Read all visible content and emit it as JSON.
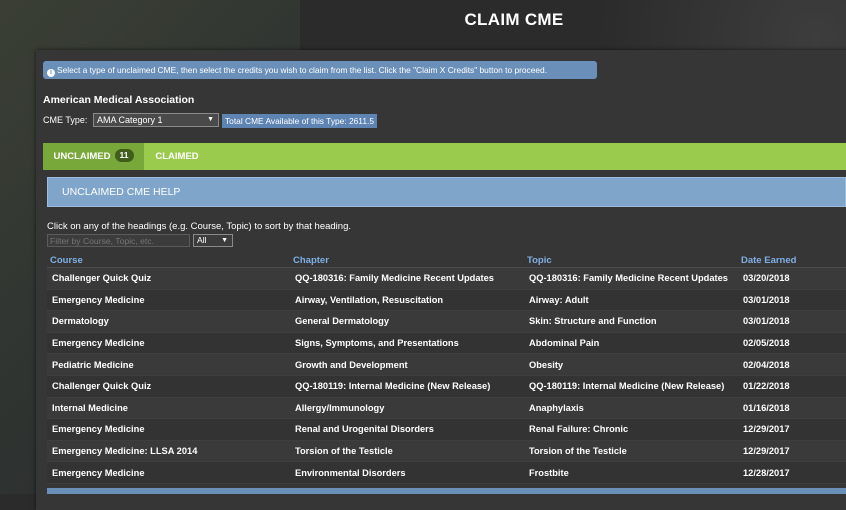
{
  "page": {
    "title": "CLAIM CME"
  },
  "info": {
    "text": "Select a type of unclaimed CME, then select the credits you wish to claim from the list. Click the \"Claim X Credits\" button to proceed."
  },
  "org": {
    "name": "American Medical Association"
  },
  "cme_type": {
    "label": "CME Type:",
    "selected": "AMA Category 1",
    "total_label": "Total CME Available of this Type: 2611.5"
  },
  "tabs": [
    {
      "label": "UNCLAIMED",
      "count": "11",
      "active": true
    },
    {
      "label": "CLAIMED",
      "active": false
    }
  ],
  "help": {
    "label": "UNCLAIMED CME HELP"
  },
  "sort_note": "Click on any of the headings (e.g. Course, Topic) to sort by that heading.",
  "filter": {
    "placeholder": "Filter by Course, Topic, etc.",
    "select_value": "All"
  },
  "table": {
    "headers": {
      "course": "Course",
      "chapter": "Chapter",
      "topic": "Topic",
      "date": "Date Earned"
    },
    "rows": [
      {
        "course": "Challenger Quick Quiz",
        "chapter": "QQ-180316: Family Medicine Recent Updates",
        "topic": "QQ-180316: Family Medicine Recent Updates",
        "date": "03/20/2018"
      },
      {
        "course": "Emergency Medicine",
        "chapter": "Airway, Ventilation, Resuscitation",
        "topic": "Airway: Adult",
        "date": "03/01/2018"
      },
      {
        "course": "Dermatology",
        "chapter": "General Dermatology",
        "topic": "Skin: Structure and Function",
        "date": "03/01/2018"
      },
      {
        "course": "Emergency Medicine",
        "chapter": "Signs, Symptoms, and Presentations",
        "topic": "Abdominal Pain",
        "date": "02/05/2018"
      },
      {
        "course": "Pediatric Medicine",
        "chapter": "Growth and Development",
        "topic": "Obesity",
        "date": "02/04/2018"
      },
      {
        "course": "Challenger Quick Quiz",
        "chapter": "QQ-180119: Internal Medicine (New Release)",
        "topic": "QQ-180119: Internal Medicine (New Release)",
        "date": "01/22/2018"
      },
      {
        "course": "Internal Medicine",
        "chapter": "Allergy/Immunology",
        "topic": "Anaphylaxis",
        "date": "01/16/2018"
      },
      {
        "course": "Emergency Medicine",
        "chapter": "Renal and Urogenital Disorders",
        "topic": "Renal Failure: Chronic",
        "date": "12/29/2017"
      },
      {
        "course": "Emergency Medicine: LLSA 2014",
        "chapter": "Torsion of the Testicle",
        "topic": "Torsion of the Testicle",
        "date": "12/29/2017"
      },
      {
        "course": "Emergency Medicine",
        "chapter": "Environmental Disorders",
        "topic": "Frostbite",
        "date": "12/28/2017"
      }
    ]
  },
  "colors": {
    "accent_green": "#9bcb4c",
    "tab_active": "#79a83a",
    "info_blue": "#6a8fb8",
    "header_blue": "#7fb0e6"
  }
}
